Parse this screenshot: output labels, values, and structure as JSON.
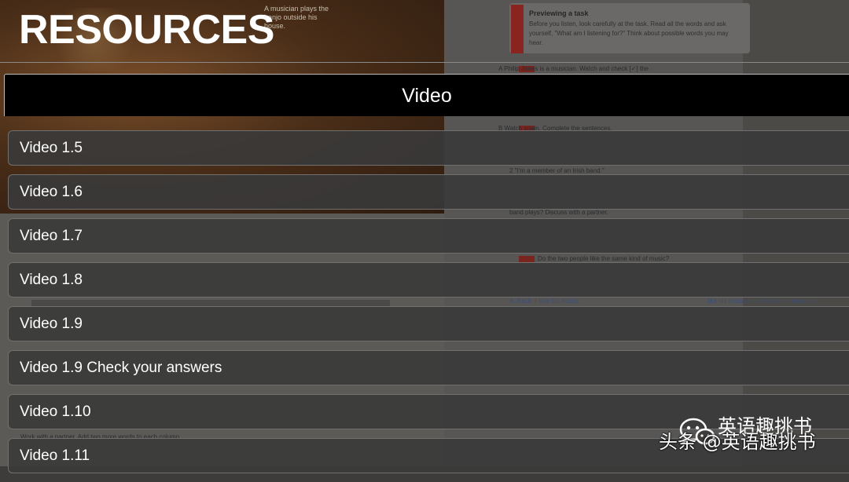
{
  "header": {
    "title": "RESOURCES"
  },
  "dialog": {
    "title": "Video",
    "items": [
      {
        "label": "Video 1.5"
      },
      {
        "label": "Video 1.6"
      },
      {
        "label": "Video 1.7"
      },
      {
        "label": "Video 1.8"
      },
      {
        "label": "Video 1.9"
      },
      {
        "label": "Video 1.9 Check your answers"
      },
      {
        "label": "Video 1.10"
      },
      {
        "label": "Video 1.11"
      }
    ]
  },
  "background": {
    "caption": "A musician plays the banjo outside his house.",
    "tip_title": "Previewing a task",
    "tip_body": "Before you listen, look carefully at the task. Read all the words and ask yourself, \"What am I listening for?\" Think about possible words you may hear.",
    "lines": [
      "A   Philip Jones is a musician. Watch and check [✓] the",
      "B   Watch again. Complete the sentences.",
      "2  \"I'm a member of an Irish                             band.\"",
      "band plays? Discuss with a partner.",
      "Do the two people like the same kind of music?",
      "A:  Bach. I love his music.",
      "like his music a lot / really like his music",
      "Work with a partner. Add two more words to each column."
    ]
  },
  "watermark": {
    "brand": "头条",
    "handle": "@英语趣挑书",
    "account": "英语趣挑书"
  },
  "colors": {
    "dialog_header_bg": "#000000",
    "list_item_bg": "#3a3a3a",
    "text": "#ffffff",
    "accent_red": "#8a2420"
  }
}
